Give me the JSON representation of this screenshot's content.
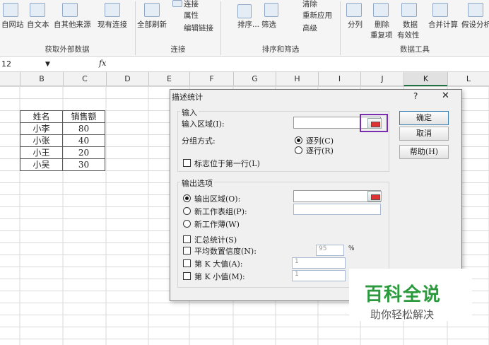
{
  "ribbon": {
    "buttons": [
      "自网站",
      "自文本",
      "自其他来源",
      "现有连接",
      "全部刷新",
      "连接",
      "属性",
      "编辑链接",
      "排序...",
      "筛选",
      "清除",
      "重新应用",
      "高级",
      "分列",
      "删除",
      "重复项",
      "数据",
      "有效性",
      "合并计算",
      "假设分析"
    ],
    "groups": [
      "获取外部数据",
      "连接",
      "排序和筛选",
      "数据工具"
    ]
  },
  "formula_bar": {
    "name_box": "12",
    "fx": "fx"
  },
  "columns": [
    "B",
    "C",
    "D",
    "E",
    "F",
    "G",
    "H",
    "I",
    "J",
    "K",
    "L"
  ],
  "table": {
    "header": [
      "姓名",
      "销售额"
    ],
    "rows": [
      [
        "小李",
        "80"
      ],
      [
        "小张",
        "40"
      ],
      [
        "小王",
        "20"
      ],
      [
        "小吴",
        "30"
      ]
    ]
  },
  "dialog": {
    "title": "描述统计",
    "help": "?",
    "close": "✕",
    "input_section": "输入",
    "input_range_label": "输入区域(I):",
    "grouping_label": "分组方式:",
    "by_col": "逐列(C)",
    "by_row": "逐行(R)",
    "labels_first_row": "标志位于第一行(L)",
    "output_section": "输出选项",
    "output_range": "输出区域(O):",
    "new_sheet": "新工作表组(P):",
    "new_workbook": "新工作薄(W)",
    "summary": "汇总统计(S)",
    "confidence": "平均数置信度(N):",
    "confidence_value": "95",
    "percent": "%",
    "kth_largest": "第 K 大值(A):",
    "kth_largest_value": "1",
    "kth_smallest": "第 K 小值(M):",
    "kth_smallest_value": "1",
    "ok": "确定",
    "cancel": "取消",
    "help_btn": "帮助(H)"
  },
  "watermark": {
    "title": "百科全说",
    "subtitle": "助你轻松解决"
  }
}
